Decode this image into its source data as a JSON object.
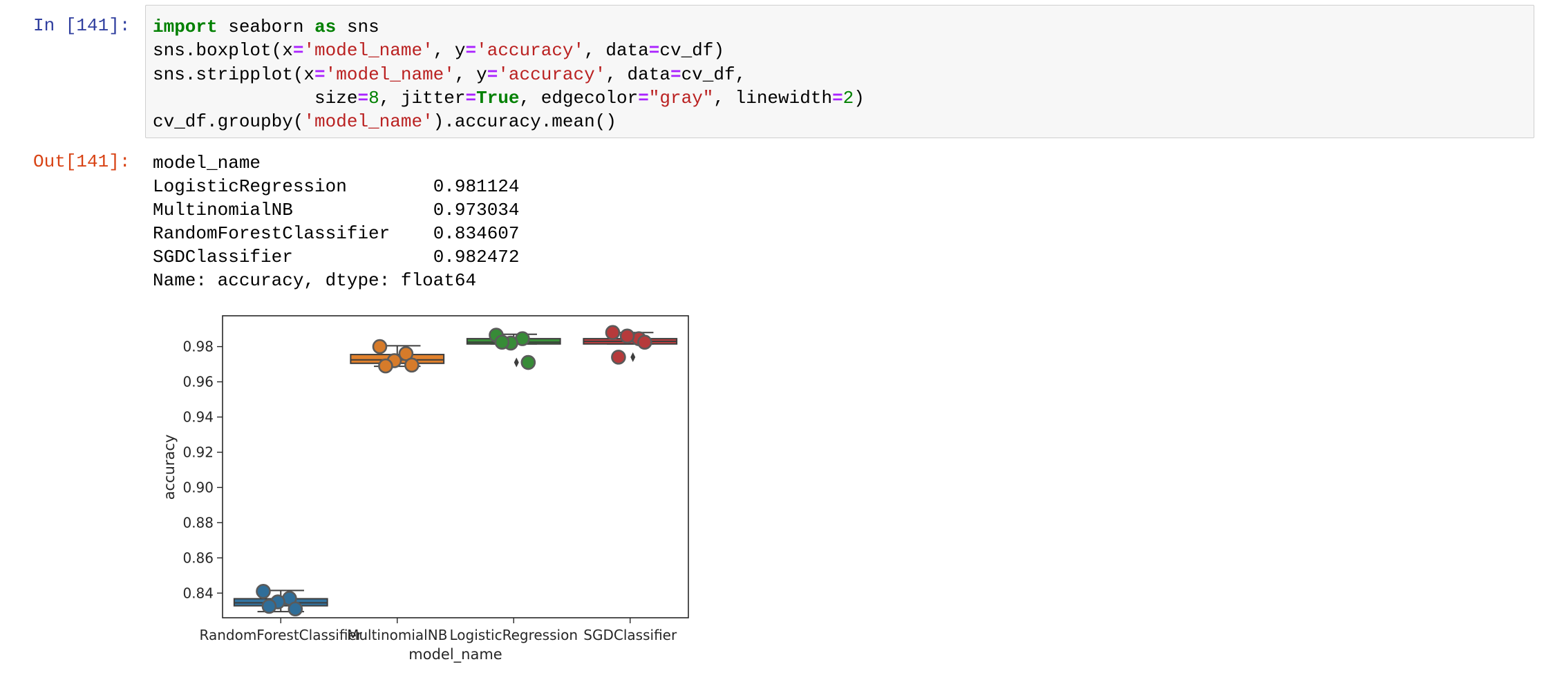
{
  "input_prompt": "In [141]:",
  "output_prompt": "Out[141]:",
  "code": {
    "line1": {
      "kw1": "import",
      "t1": " seaborn ",
      "kw2": "as",
      "t2": " sns"
    },
    "line2": {
      "a": "sns.boxplot(x",
      "eq1": "=",
      "s1": "'model_name'",
      "b": ", y",
      "eq2": "=",
      "s2": "'accuracy'",
      "c": ", data",
      "eq3": "=",
      "d": "cv_df)"
    },
    "line3": {
      "a": "sns.stripplot(x",
      "eq1": "=",
      "s1": "'model_name'",
      "b": ", y",
      "eq2": "=",
      "s2": "'accuracy'",
      "c": ", data",
      "eq3": "=",
      "d": "cv_df,"
    },
    "line4": {
      "a": "size",
      "eq1": "=",
      "n1": "8",
      "b": ", jitter",
      "eq2": "=",
      "kw": "True",
      "c": ", edgecolor",
      "eq3": "=",
      "s1": "\"gray\"",
      "d": ", linewidth",
      "eq4": "=",
      "n2": "2",
      "e": ")"
    },
    "line5": {
      "a": "cv_df.groupby(",
      "s1": "'model_name'",
      "b": ").accuracy.mean()"
    }
  },
  "output_text": {
    "header": "model_name",
    "rows": [
      {
        "name": "LogisticRegression",
        "value": "0.981124"
      },
      {
        "name": "MultinomialNB",
        "value": "0.973034"
      },
      {
        "name": "RandomForestClassifier",
        "value": "0.834607"
      },
      {
        "name": "SGDClassifier",
        "value": "0.982472"
      }
    ],
    "footer": "Name: accuracy, dtype: float64"
  },
  "chart_data": {
    "type": "box",
    "xlabel": "model_name",
    "ylabel": "accuracy",
    "ylim": [
      0.826,
      0.9975
    ],
    "yticks": [
      0.84,
      0.86,
      0.88,
      0.9,
      0.92,
      0.94,
      0.96,
      0.98
    ],
    "ytick_labels": [
      "0.84",
      "0.86",
      "0.88",
      "0.90",
      "0.92",
      "0.94",
      "0.96",
      "0.98"
    ],
    "categories": [
      "RandomForestClassifier",
      "MultinomialNB",
      "LogisticRegression",
      "SGDClassifier"
    ],
    "colors": [
      "#3274a1",
      "#e1812c",
      "#3a923a",
      "#c03d3e"
    ],
    "boxes": [
      {
        "q1": 0.8328,
        "median": 0.8345,
        "q3": 0.8368,
        "whisker_low": 0.8295,
        "whisker_high": 0.8415,
        "fliers": []
      },
      {
        "q1": 0.9705,
        "median": 0.9725,
        "q3": 0.9755,
        "whisker_low": 0.9688,
        "whisker_high": 0.9805,
        "fliers": []
      },
      {
        "q1": 0.9815,
        "median": 0.9825,
        "q3": 0.9845,
        "whisker_low": 0.9815,
        "whisker_high": 0.987,
        "fliers": [
          0.971
        ]
      },
      {
        "q1": 0.9815,
        "median": 0.983,
        "q3": 0.9845,
        "whisker_low": 0.9815,
        "whisker_high": 0.988,
        "fliers": [
          0.974
        ]
      }
    ],
    "points": [
      [
        0.841,
        0.837,
        0.835,
        0.831,
        0.8325
      ],
      [
        0.98,
        0.976,
        0.972,
        0.9695,
        0.969
      ],
      [
        0.9865,
        0.9845,
        0.982,
        0.971,
        0.9825
      ],
      [
        0.988,
        0.9845,
        0.986,
        0.9825,
        0.974
      ]
    ]
  }
}
